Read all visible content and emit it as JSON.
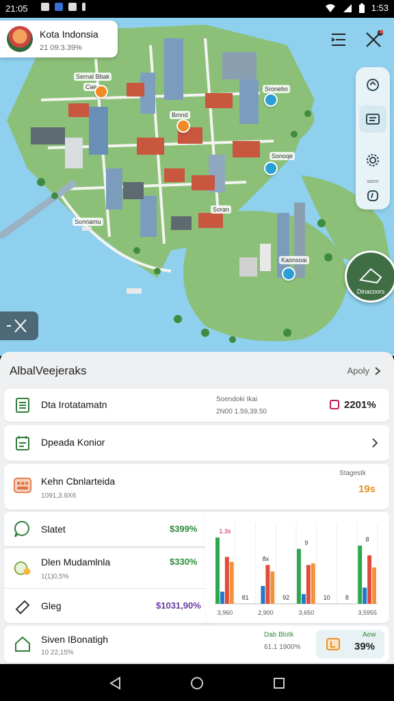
{
  "status": {
    "time": "21:05",
    "clock": "1:53"
  },
  "app": {
    "title": "Kota Indonsia",
    "subtitle": "21 09:3.39%"
  },
  "map_labels": [
    {
      "text": "Sernal Bbak"
    },
    {
      "text": "Cae"
    },
    {
      "text": "Bmnd"
    },
    {
      "text": "Sronebo"
    },
    {
      "text": "Sonoqe"
    },
    {
      "text": "Sonnamu"
    },
    {
      "text": "Soran"
    },
    {
      "text": "Kaonsoai"
    }
  ],
  "rail": {
    "label": "aatee"
  },
  "thumb": {
    "label": "Dinacoors"
  },
  "sheet": {
    "title": "AlbalVeejeraks",
    "apply": "Apoly"
  },
  "rows": [
    {
      "name": "Dta Irotatamatn",
      "mid_label": "Soendoki Ikai",
      "mid_value": "2N00 1.59,39.50",
      "value": "2201%",
      "value_color": "#222"
    },
    {
      "name": "Dpeada Konior"
    },
    {
      "name": "Kehn Cbnlarteida",
      "sub": "1091,3.9X6",
      "rlabel": "Stagestk",
      "value": "19s",
      "value_color": "#e69324"
    },
    {
      "name": "Slatet",
      "value": "$399%",
      "value_color": "#2e8b3a"
    },
    {
      "name": "Dlen Mudamlnla",
      "sub": "1(1)0,5%",
      "value": "$330%",
      "value_color": "#2e8b3a"
    },
    {
      "name": "Gleg",
      "value": "$1031,90%",
      "value_color": "#6a3aa0"
    },
    {
      "name": "Siven IBonatigh",
      "sub": "10 22,15%",
      "mid_label": "Dab Blotk",
      "mid_value": "61.1 1900%",
      "rlabel": "Aew",
      "value": "39%",
      "value_color": "#222"
    }
  ],
  "chart_data": {
    "type": "bar",
    "categories": [
      "3,960",
      "",
      "2,900",
      "",
      "3,650",
      "",
      "",
      "3,5955"
    ],
    "series": [
      {
        "color": "#2aa84a",
        "values": [
          82,
          0,
          0,
          0,
          68,
          0,
          0,
          72
        ]
      },
      {
        "color": "#1f78c8",
        "values": [
          15,
          0,
          22,
          0,
          12,
          0,
          0,
          20
        ]
      },
      {
        "color": "#e24a3b",
        "values": [
          58,
          0,
          48,
          0,
          48,
          0,
          0,
          60
        ]
      },
      {
        "color": "#f0923a",
        "values": [
          52,
          0,
          40,
          0,
          50,
          0,
          0,
          45
        ]
      }
    ],
    "data_labels": [
      "1.3s",
      "81",
      "8x",
      "92",
      "9",
      "10",
      "8",
      "8"
    ],
    "ylim": [
      0,
      100
    ]
  }
}
